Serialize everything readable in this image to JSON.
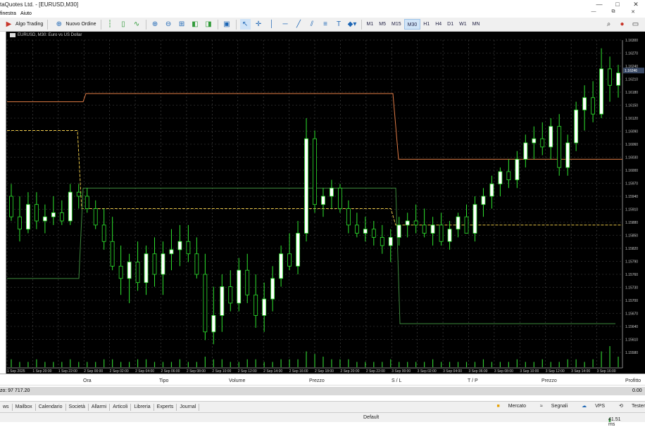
{
  "window": {
    "title": "taQuotes Ltd. - [EURUSD,M30]",
    "min": "—",
    "max": "□",
    "close": "✕"
  },
  "menu": {
    "items": [
      "finestra",
      "Aiuto"
    ],
    "mdi": [
      "—",
      "⧉",
      "✕"
    ]
  },
  "toolbar": {
    "algo_trading": "Algo Trading",
    "new_order": "Nuovo Ordine",
    "timeframes": [
      "M1",
      "M5",
      "M15",
      "M30",
      "H1",
      "H4",
      "D1",
      "W1",
      "MN"
    ],
    "active_timeframe": "M30"
  },
  "chart": {
    "symbol_title": "EURUSD, M30:  Euro vs US Dollar",
    "price_labels": [
      "1.16300",
      "1.16270",
      "1.16240",
      "1.16210",
      "1.16180",
      "1.16150",
      "1.16120",
      "1.16090",
      "1.16060",
      "1.16030",
      "1.16000",
      "1.15970",
      "1.15940",
      "1.15910",
      "1.15880",
      "1.15850",
      "1.15820",
      "1.15790",
      "1.15760",
      "1.15730",
      "1.15700",
      "1.15670",
      "1.15640",
      "1.15610",
      "1.15580"
    ],
    "current_price": "1.16246",
    "time_labels": [
      "1 Sep 2025",
      "1 Sep 20:00",
      "1 Sep 22:00",
      "2 Sep 00:00",
      "2 Sep 02:00",
      "2 Sep 04:00",
      "2 Sep 06:00",
      "2 Sep 08:00",
      "2 Sep 10:00",
      "2 Sep 12:00",
      "2 Sep 14:00",
      "2 Sep 16:00",
      "2 Sep 18:00",
      "2 Sep 20:00",
      "2 Sep 22:00",
      "3 Sep 00:00",
      "3 Sep 02:00",
      "3 Sep 04:00",
      "3 Sep 06:00",
      "3 Sep 08:00",
      "3 Sep 10:00",
      "3 Sep 12:00",
      "3 Sep 14:00",
      "3 Sep 16:00"
    ],
    "colors": {
      "background": "#000000",
      "grid": "#4a4a4a",
      "bull": "#ffffff",
      "bear": "#000000",
      "wick": "#2ee52e",
      "volume": "#2fc62f",
      "upper_level": "#e07b45",
      "mid_level": "#e8c547",
      "lower_level": "#3d8a3d"
    }
  },
  "chart_data": {
    "type": "candlestick",
    "x": [
      "1 Sep 2025 18:00",
      "1 Sep 20:00",
      "1 Sep 22:00",
      "2 Sep 00:00",
      "2 Sep 02:00",
      "2 Sep 04:00",
      "2 Sep 06:00",
      "2 Sep 08:00",
      "2 Sep 10:00",
      "2 Sep 12:00",
      "2 Sep 14:00",
      "2 Sep 16:00",
      "2 Sep 18:00",
      "2 Sep 20:00",
      "2 Sep 22:00",
      "3 Sep 00:00",
      "3 Sep 02:00",
      "3 Sep 04:00",
      "3 Sep 06:00",
      "3 Sep 08:00",
      "3 Sep 10:00",
      "3 Sep 12:00",
      "3 Sep 14:00",
      "3 Sep 16:00"
    ],
    "candles": [
      [
        1.1594,
        1.1597,
        1.1588,
        1.1589
      ],
      [
        1.1589,
        1.1594,
        1.1583,
        1.1586
      ],
      [
        1.1586,
        1.1595,
        1.1585,
        1.1592
      ],
      [
        1.1592,
        1.1595,
        1.1586,
        1.1588
      ],
      [
        1.1588,
        1.1592,
        1.1585,
        1.1589
      ],
      [
        1.1589,
        1.1594,
        1.1587,
        1.159
      ],
      [
        1.159,
        1.1593,
        1.1587,
        1.1588
      ],
      [
        1.1588,
        1.1597,
        1.1587,
        1.1595
      ],
      [
        1.1595,
        1.1597,
        1.1591,
        1.1594
      ],
      [
        1.1594,
        1.1596,
        1.159,
        1.1591
      ],
      [
        1.1591,
        1.1593,
        1.1586,
        1.1587
      ],
      [
        1.1587,
        1.1591,
        1.1581,
        1.1583
      ],
      [
        1.1583,
        1.1589,
        1.1576,
        1.1577
      ],
      [
        1.1577,
        1.1582,
        1.157,
        1.1574
      ],
      [
        1.1574,
        1.158,
        1.1568,
        1.1578
      ],
      [
        1.1578,
        1.1583,
        1.1571,
        1.1573
      ],
      [
        1.1573,
        1.1582,
        1.157,
        1.158
      ],
      [
        1.158,
        1.1584,
        1.1572,
        1.1575
      ],
      [
        1.1575,
        1.1583,
        1.157,
        1.158
      ],
      [
        1.158,
        1.1586,
        1.1576,
        1.1581
      ],
      [
        1.1581,
        1.1587,
        1.1577,
        1.1583
      ],
      [
        1.1583,
        1.1587,
        1.1578,
        1.158
      ],
      [
        1.158,
        1.1584,
        1.1574,
        1.1575
      ],
      [
        1.1575,
        1.158,
        1.1559,
        1.1561
      ],
      [
        1.1561,
        1.1572,
        1.1558,
        1.1565
      ],
      [
        1.1565,
        1.1575,
        1.1561,
        1.1572
      ],
      [
        1.1572,
        1.1576,
        1.1566,
        1.1568
      ],
      [
        1.1568,
        1.1579,
        1.1566,
        1.1576
      ],
      [
        1.1576,
        1.158,
        1.1568,
        1.157
      ],
      [
        1.157,
        1.1575,
        1.1562,
        1.1565
      ],
      [
        1.1565,
        1.1573,
        1.1561,
        1.1569
      ],
      [
        1.1569,
        1.1577,
        1.1566,
        1.1574
      ],
      [
        1.1574,
        1.1582,
        1.1572,
        1.158
      ],
      [
        1.158,
        1.1585,
        1.1576,
        1.1577
      ],
      [
        1.1577,
        1.1588,
        1.1575,
        1.1585
      ],
      [
        1.1585,
        1.1613,
        1.1583,
        1.1608
      ],
      [
        1.1608,
        1.161,
        1.159,
        1.1592
      ],
      [
        1.1592,
        1.1596,
        1.1589,
        1.1594
      ],
      [
        1.1594,
        1.1598,
        1.1591,
        1.1596
      ],
      [
        1.1596,
        1.1597,
        1.159,
        1.1591
      ],
      [
        1.1591,
        1.1593,
        1.1585,
        1.1587
      ],
      [
        1.1587,
        1.159,
        1.1584,
        1.1585
      ],
      [
        1.1585,
        1.1589,
        1.1583,
        1.1586
      ],
      [
        1.1586,
        1.1588,
        1.1582,
        1.1584
      ],
      [
        1.1584,
        1.1587,
        1.158,
        1.1582
      ],
      [
        1.1582,
        1.1586,
        1.1578,
        1.1584
      ],
      [
        1.1584,
        1.1589,
        1.1582,
        1.1587
      ],
      [
        1.1587,
        1.159,
        1.1584,
        1.1588
      ],
      [
        1.1588,
        1.1592,
        1.1585,
        1.1587
      ],
      [
        1.1587,
        1.1591,
        1.1584,
        1.1585
      ],
      [
        1.1585,
        1.1589,
        1.1582,
        1.1587
      ],
      [
        1.1587,
        1.159,
        1.1582,
        1.1583
      ],
      [
        1.1583,
        1.1588,
        1.1581,
        1.1586
      ],
      [
        1.1586,
        1.159,
        1.1584,
        1.1589
      ],
      [
        1.1589,
        1.1592,
        1.1585,
        1.1585
      ],
      [
        1.1585,
        1.1594,
        1.1583,
        1.1592
      ],
      [
        1.1592,
        1.1596,
        1.1589,
        1.1594
      ],
      [
        1.1594,
        1.1599,
        1.1591,
        1.1597
      ],
      [
        1.1597,
        1.1601,
        1.1594,
        1.16
      ],
      [
        1.16,
        1.1603,
        1.1596,
        1.1598
      ],
      [
        1.1598,
        1.1605,
        1.1596,
        1.1603
      ],
      [
        1.1603,
        1.1609,
        1.1601,
        1.1607
      ],
      [
        1.1607,
        1.1611,
        1.1603,
        1.1608
      ],
      [
        1.1608,
        1.1612,
        1.1604,
        1.1606
      ],
      [
        1.1606,
        1.1613,
        1.1603,
        1.1611
      ],
      [
        1.1611,
        1.1614,
        1.1599,
        1.1601
      ],
      [
        1.1601,
        1.1609,
        1.1599,
        1.1607
      ],
      [
        1.1607,
        1.1617,
        1.1605,
        1.1615
      ],
      [
        1.1615,
        1.1621,
        1.161,
        1.1618
      ],
      [
        1.1618,
        1.1622,
        1.1612,
        1.1614
      ],
      [
        1.1614,
        1.163,
        1.1613,
        1.1625
      ],
      [
        1.1625,
        1.1628,
        1.1617,
        1.1621
      ],
      [
        1.1621,
        1.1626,
        1.1618,
        1.1624
      ]
    ],
    "volume": [
      3,
      2,
      2,
      3,
      2,
      2,
      2,
      3,
      2,
      2,
      2,
      3,
      3,
      2,
      2,
      3,
      3,
      2,
      2,
      2,
      3,
      2,
      2,
      4,
      3,
      3,
      2,
      2,
      3,
      3,
      2,
      2,
      3,
      3,
      3,
      6,
      5,
      4,
      3,
      3,
      3,
      2,
      2,
      2,
      2,
      3,
      2,
      2,
      2,
      2,
      3,
      2,
      2,
      2,
      2,
      2,
      3,
      2,
      2,
      2,
      3,
      2,
      2,
      3,
      2,
      2,
      3,
      3,
      2,
      3,
      6,
      8,
      4
    ],
    "ylim": [
      1.1556,
      1.1632
    ]
  },
  "trade": {
    "columns": [
      "Ora",
      "Tipo",
      "Volume",
      "Prezzo",
      "S / L",
      "T / P",
      "Prezzo",
      "Profitto"
    ],
    "balance_label": "zo: 97 717.20",
    "profit": "0.00"
  },
  "tabs": {
    "items": [
      "ws",
      "Mailbox",
      "Calendario",
      "Società",
      "Allarmi",
      "Articoli",
      "Libreria",
      "Experts",
      "Journal"
    ],
    "right": [
      "Mercato",
      "Segnali",
      "VPS",
      "Tester"
    ]
  },
  "status": {
    "profile": "Default",
    "ping": "41.51 ms"
  }
}
